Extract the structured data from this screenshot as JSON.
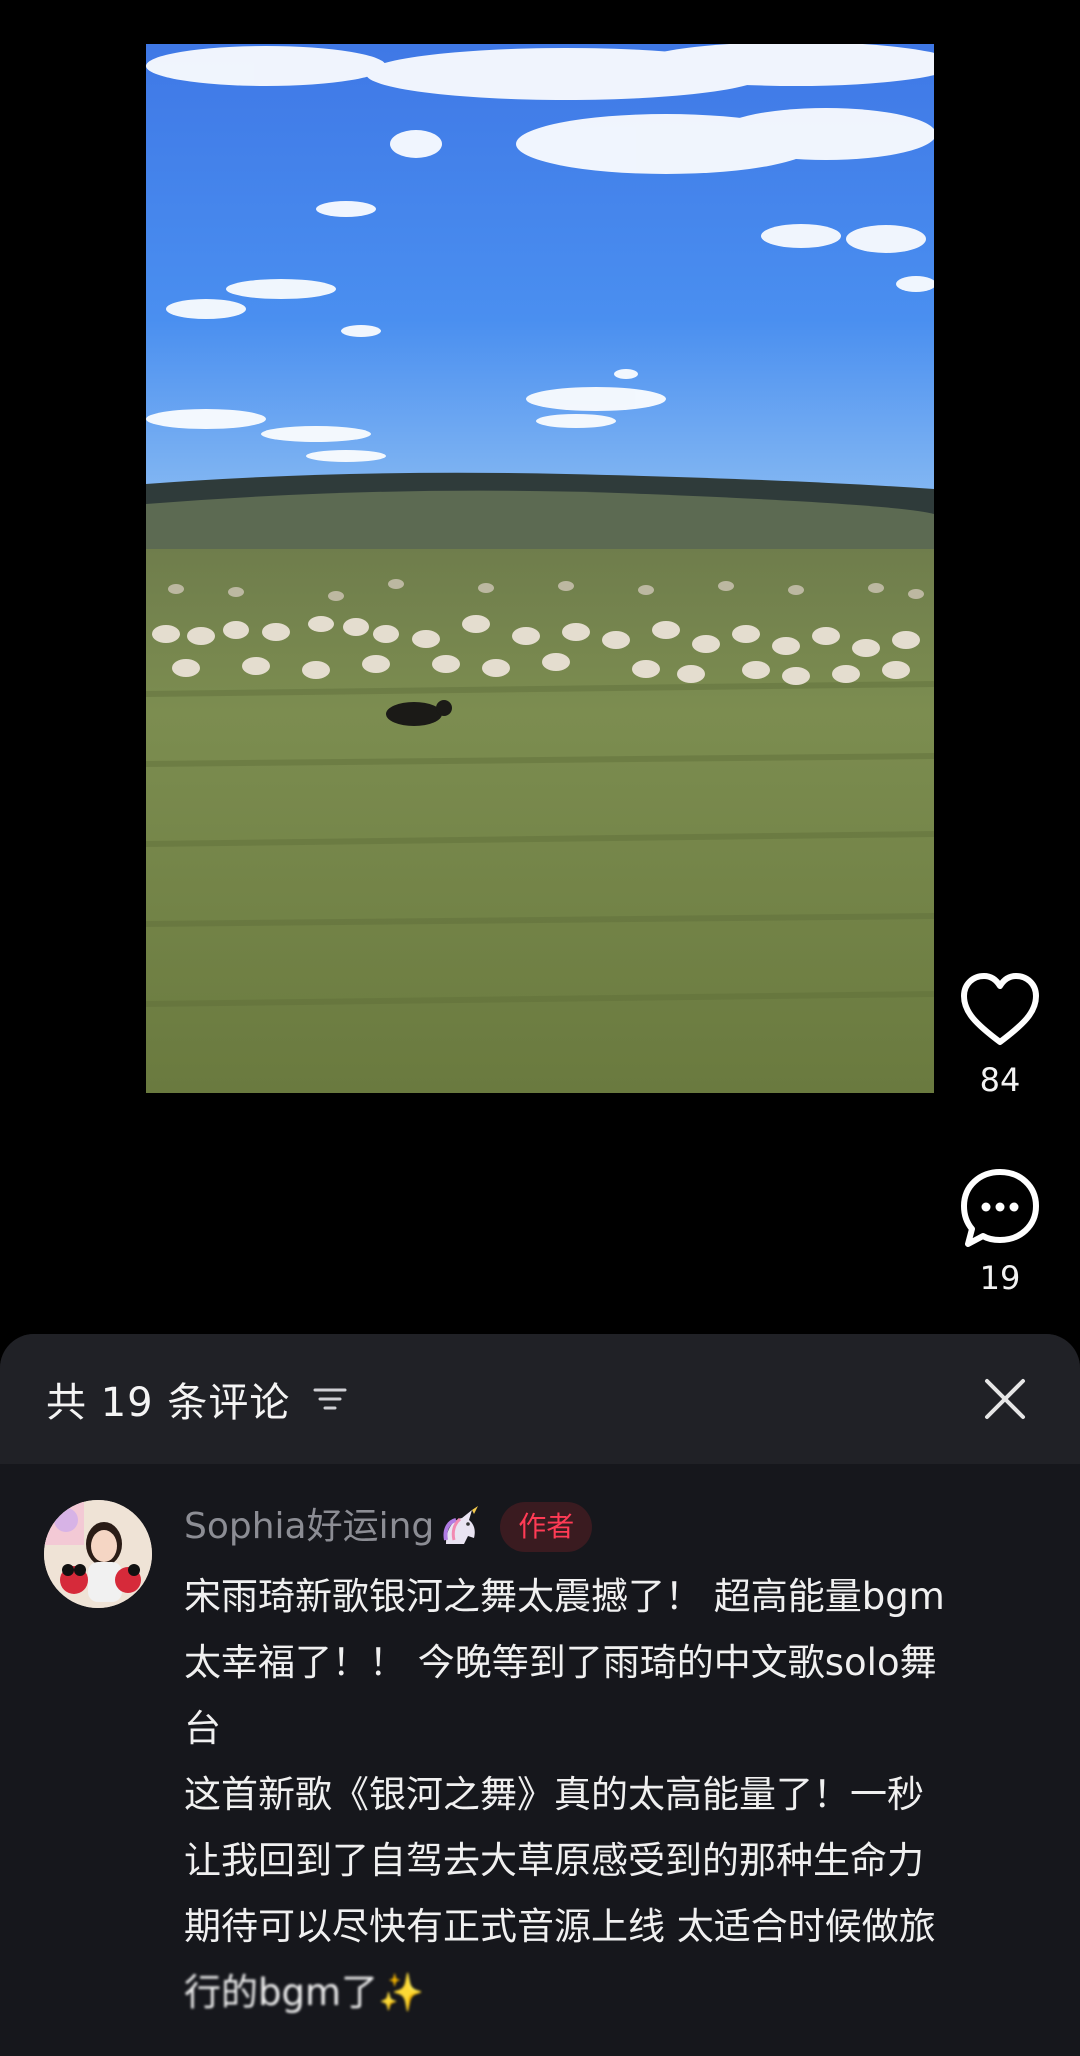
{
  "media": {
    "description_icon": "landscape-photo"
  },
  "actions": {
    "like_count": "84",
    "comment_count": "19"
  },
  "comments_panel": {
    "title": "共 19 条评论",
    "sort_icon": "sort-lines-icon",
    "close_icon": "close-icon"
  },
  "comment": {
    "username": "Sophia好运ing",
    "username_emoji": "unicorn-icon",
    "badge": "作者",
    "lines": [
      "宋雨琦新歌银河之舞太震撼了！ 超高能量bgm",
      "太幸福了！！ 今晚等到了雨琦的中文歌solo舞",
      "台",
      "这首新歌《银河之舞》真的太高能量了！一秒",
      "让我回到了自驾去大草原感受到的那种生命力",
      "期待可以尽快有正式音源上线 太适合时候做旅"
    ],
    "last_line_partial": "行的bgm了",
    "sparkle": "✨"
  },
  "colors": {
    "background": "#000000",
    "sheet": "#16171c",
    "sheet_header": "#202126",
    "badge_text": "#ff3b55",
    "username": "#8c8d94"
  }
}
